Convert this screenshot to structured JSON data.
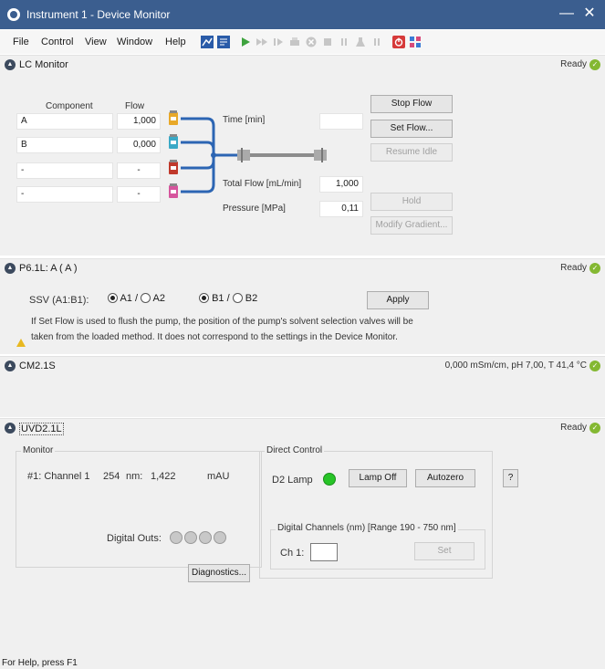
{
  "window": {
    "title": "Instrument 1 - Device Monitor",
    "minimize": "—",
    "close": "✕"
  },
  "menu": {
    "items": [
      {
        "label": "File"
      },
      {
        "label": "Control"
      },
      {
        "label": "View"
      },
      {
        "label": "Window"
      },
      {
        "label": "Help"
      }
    ]
  },
  "toolbar": {
    "icons": [
      "chart-icon",
      "report-icon",
      "play-icon",
      "fast-forward-icon",
      "step-icon",
      "print-icon",
      "stop-circle-icon",
      "stop-square-icon",
      "pause-icon",
      "flask-icon",
      "pause-bars-icon",
      "power-icon",
      "network-icon"
    ]
  },
  "lc_monitor": {
    "title": "LC Monitor",
    "status": "Ready",
    "headers": {
      "component": "Component",
      "flow": "Flow"
    },
    "rows": [
      {
        "component": "A",
        "flow": "1,000",
        "bottle_color": "#e8a828"
      },
      {
        "component": "B",
        "flow": "0,000",
        "bottle_color": "#3aa9c6"
      },
      {
        "component": "-",
        "flow": "-",
        "bottle_color": "#c0392b"
      },
      {
        "component": "-",
        "flow": "-",
        "bottle_color": "#d6559d"
      }
    ],
    "time_label": "Time [min]",
    "time_value": "",
    "total_flow_label": "Total Flow [mL/min]",
    "total_flow_value": "1,000",
    "pressure_label": "Pressure [MPa]",
    "pressure_value": "0,11",
    "buttons": {
      "stop_flow": "Stop Flow",
      "set_flow": "Set Flow...",
      "resume_idle": "Resume Idle",
      "hold": "Hold",
      "modify_gradient": "Modify Gradient..."
    }
  },
  "pump": {
    "title": "P6.1L: A ( A )",
    "status": "Ready",
    "ssv_label": "SSV (A1:B1):",
    "opt_a1": "A1 /",
    "opt_a2": "A2",
    "opt_b1": "B1 /",
    "opt_b2": "B2",
    "apply": "Apply",
    "note_line1": "If Set Flow is used to flush the pump, the position of the pump's solvent selection valves will be",
    "note_line2": "taken from the loaded method. It does not correspond to the settings in the Device Monitor."
  },
  "cm": {
    "title": "CM2.1S",
    "status": "0,000 mSm/cm, pH 7,00, T 41,4 °C"
  },
  "uvd": {
    "title": "UVD2.1L",
    "status": "Ready",
    "monitor_label": "Monitor",
    "channel_name": "#1: Channel 1",
    "wavelength": "254",
    "nm_label": "nm:",
    "value": "1,422",
    "unit": "mAU",
    "digital_outs_label": "Digital Outs:",
    "diagnostics": "Diagnostics...",
    "direct_control_label": "Direct Control",
    "d2_lamp_label": "D2 Lamp",
    "lamp_off": "Lamp Off",
    "autozero": "Autozero",
    "help": "?",
    "digital_channels_label": "Digital Channels (nm) [Range 190 - 750 nm]",
    "ch1_label": "Ch 1:",
    "ch1_value": "",
    "set": "Set"
  },
  "statusbar": {
    "text": "For Help, press F1"
  },
  "colors": {
    "title_bar": "#3b5e8f",
    "ready_icon": "#84b832",
    "pipe": "#2c65b3",
    "lamp_on": "#27c427"
  }
}
